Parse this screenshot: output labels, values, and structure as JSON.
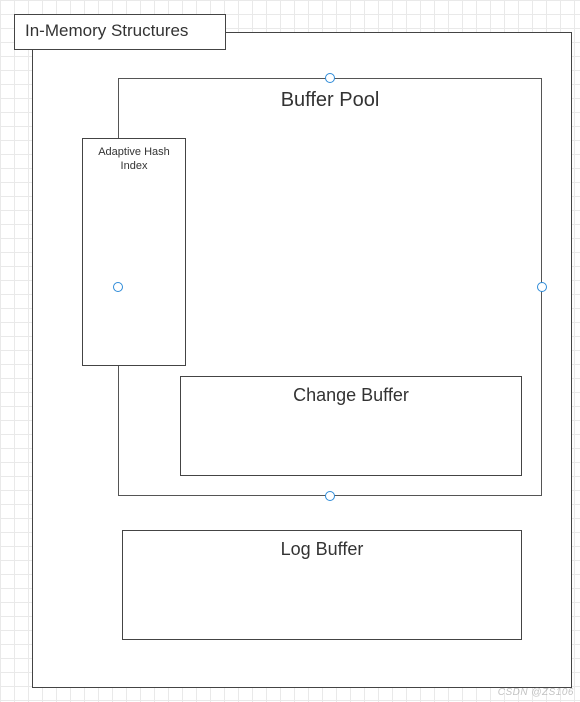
{
  "diagram": {
    "group_title": "In-Memory Structures",
    "buffer_pool": "Buffer Pool",
    "adaptive_hash": "Adaptive Hash\nIndex",
    "change_buffer": "Change Buffer",
    "log_buffer": "Log Buffer"
  },
  "watermark": "CSDN @ZS106"
}
